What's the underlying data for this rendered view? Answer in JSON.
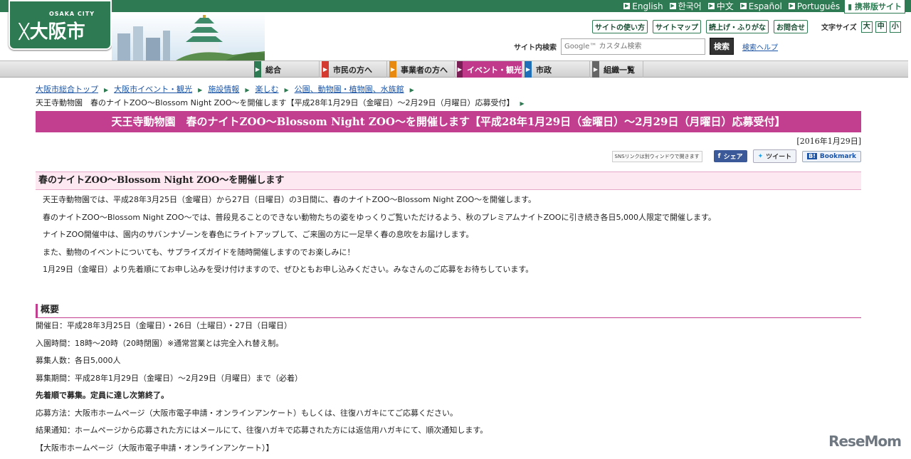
{
  "langbar": {
    "languages": [
      "English",
      "한국어",
      "中文",
      "Español",
      "Português"
    ],
    "mobile_label": "携帯版サイト"
  },
  "logo": {
    "city_en": "OSAKA CITY",
    "name": "大阪市"
  },
  "util": {
    "buttons": [
      "サイトの使い方",
      "サイトマップ",
      "読上げ・ふりがな",
      "お問合せ"
    ],
    "font_size_label": "文字サイズ",
    "font_sizes": [
      "大",
      "中",
      "小"
    ]
  },
  "search": {
    "label": "サイト内検索",
    "placeholder": "Google™ カスタム検索",
    "button": "検索",
    "help": "検索ヘルプ"
  },
  "nav": {
    "items": [
      "総合",
      "市民の方へ",
      "事業者の方へ",
      "イベント・観光",
      "市政",
      "組織一覧"
    ],
    "active": "イベント・観光",
    "colors": [
      "#2e7a52",
      "#d43a2f",
      "#e88a10",
      "#c0398a",
      "#1f6fb8",
      "#666666"
    ]
  },
  "breadcrumb": {
    "links": [
      "大阪市総合トップ",
      "大阪市イベント・観光",
      "施設情報",
      "楽しむ",
      "公園、動物園・植物園、水族館"
    ],
    "current": "天王寺動物園　春のナイトZOO～Blossom Night ZOO～を開催します【平成28年1月29日（金曜日）～2月29日（月曜日）応募受付】"
  },
  "page": {
    "title": "天王寺動物園　春のナイトZOO～Blossom Night ZOO～を開催します【平成28年1月29日（金曜日）～2月29日（月曜日）応募受付】",
    "date": "[2016年1月29日]"
  },
  "sns": {
    "note": "SNSリンクは別ウィンドウで開きます",
    "facebook": "シェア",
    "twitter": "ツイート",
    "hatena": "Bookmark"
  },
  "intro": {
    "heading": "春のナイトZOO～Blossom Night ZOO～を開催します",
    "paragraphs": [
      "天王寺動物園では、平成28年3月25日（金曜日）から27日（日曜日）の3日間に、春のナイトZOO～Blossom Night ZOO～を開催します。",
      "春のナイトZOO～Blossom Night ZOO～では、普段見ることのできない動物たちの姿をゆっくりご覧いただけるよう、秋のプレミアムナイトZOOに引き続き各日5,000人限定で開催します。",
      "ナイトZOO開催中は、園内のサバンナゾーンを春色にライトアップして、ご来園の方に一足早く春の息吹をお届けします。",
      "また、動物のイベントについても、サプライズガイドを随時開催しますのでお楽しみに！",
      "1月29日（金曜日）より先着順にてお申し込みを受け付けますので、ぜひともお申し込みください。みなさんのご応募をお待ちしています。"
    ]
  },
  "overview": {
    "heading": "概要",
    "lines": [
      "開催日：平成28年3月25日（金曜日）・26日（土曜日）・27日（日曜日）",
      "入園時間：18時～20時（20時閉園）※通常営業とは完全入れ替え制。",
      "募集人数：各日5,000人",
      "募集期間：平成28年1月29日（金曜日）～2月29日（月曜日）まで（必着）",
      "先着順で募集。定員に達し次第終了。",
      "応募方法：大阪市ホームページ（大阪市電子申請・オンラインアンケート）もしくは、往復ハガキにてご応募ください。",
      "結果通知：ホームページから応募された方にはメールにて、往復ハガキで応募された方には返信用ハガキにて、順次通知します。",
      "【大阪市ホームページ（大阪市電子申請・オンラインアンケート）】"
    ]
  },
  "watermark": "ReseMom"
}
